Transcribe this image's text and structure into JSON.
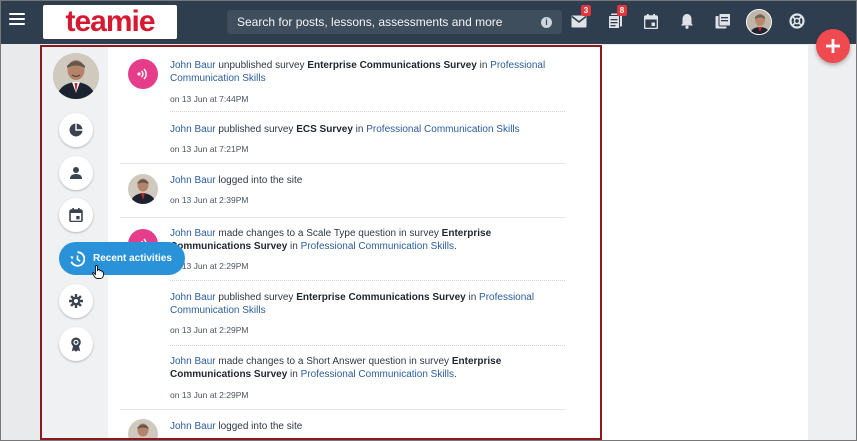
{
  "header": {
    "logo_text": "teamie",
    "search_placeholder": "Search for posts, lessons, assessments and more",
    "messages_count": "3",
    "notes_count": "8"
  },
  "sidebar": {
    "recent_label": "Recent activities"
  },
  "feed": [
    {
      "icon": "survey-app-icon",
      "actor": "John Baur",
      "action": " unpublished survey ",
      "subject": "Enterprise Communications Survey",
      "connector": " in ",
      "group": "Professional Communication Skills",
      "tail": "",
      "time": "on 13 Jun at 7:44PM"
    },
    {
      "icon": "none",
      "actor": "John Baur",
      "action": " published survey ",
      "subject": "ECS Survey",
      "connector": " in ",
      "group": "Professional Communication Skills",
      "tail": "",
      "time": "on 13 Jun at 7:21PM"
    },
    {
      "icon": "user-avatar",
      "actor": "John Baur",
      "action": " logged into the site",
      "subject": "",
      "connector": "",
      "group": "",
      "tail": "",
      "time": "on 13 Jun at 2:39PM"
    },
    {
      "icon": "survey-app-icon",
      "actor": "John Baur",
      "action": " made changes to a Scale Type question in survey ",
      "subject": "Enterprise Communications Survey",
      "connector": " in ",
      "group": "Professional Communication Skills",
      "tail": ".",
      "time": "on 13 Jun at 2:29PM"
    },
    {
      "icon": "none",
      "actor": "John Baur",
      "action": " published survey ",
      "subject": "Enterprise Communications Survey",
      "connector": " in ",
      "group": "Professional Communication Skills",
      "tail": "",
      "time": "on 13 Jun at 2:29PM"
    },
    {
      "icon": "none",
      "actor": "John Baur",
      "action": " made changes to a Short Answer question in survey ",
      "subject": "Enterprise Communications Survey",
      "connector": " in ",
      "group": "Professional Communication Skills",
      "tail": ".",
      "time": "on 13 Jun at 2:29PM"
    },
    {
      "icon": "user-avatar",
      "actor": "John Baur",
      "action": " logged into the site",
      "subject": "",
      "connector": "",
      "group": "",
      "tail": "",
      "time": ""
    }
  ]
}
